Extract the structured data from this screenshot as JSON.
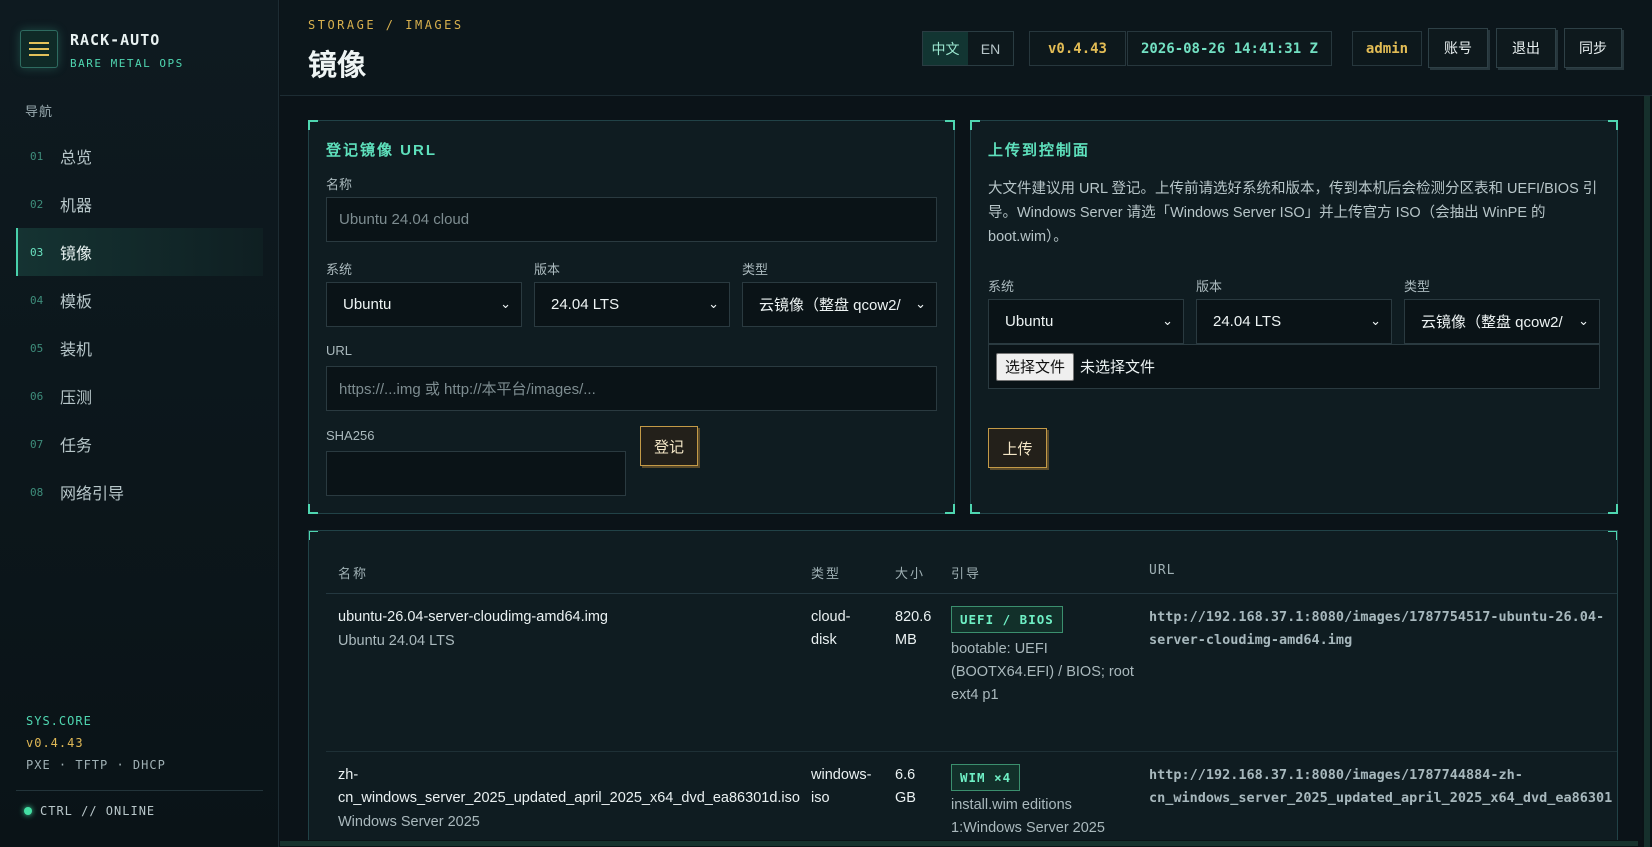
{
  "brand": {
    "title": "RACK-AUTO",
    "subtitle": "BARE METAL OPS"
  },
  "nav": {
    "title": "导航",
    "items": [
      {
        "num": "01",
        "label": "总览"
      },
      {
        "num": "02",
        "label": "机器"
      },
      {
        "num": "03",
        "label": "镜像",
        "active": true
      },
      {
        "num": "04",
        "label": "模板"
      },
      {
        "num": "05",
        "label": "装机"
      },
      {
        "num": "06",
        "label": "压测"
      },
      {
        "num": "07",
        "label": "任务"
      },
      {
        "num": "08",
        "label": "网络引导"
      }
    ]
  },
  "sys": {
    "core": "SYS.CORE",
    "version": "v0.4.43",
    "services": "PXE · TFTP · DHCP",
    "status": "CTRL // ONLINE"
  },
  "header": {
    "breadcrumb": "STORAGE / IMAGES",
    "title": "镜像",
    "lang_zh": "中文",
    "lang_en": "EN",
    "version": "v0.4.43",
    "time": "2026-08-26 14:41:31 Z",
    "user": "admin",
    "account": "账号",
    "logout": "退出",
    "sync": "同步"
  },
  "register": {
    "title": "登记镜像 URL",
    "name_label": "名称",
    "name_placeholder": "Ubuntu 24.04 cloud",
    "os_label": "系统",
    "os_value": "Ubuntu",
    "version_label": "版本",
    "version_value": "24.04 LTS",
    "type_label": "类型",
    "type_value": "云镜像（整盘 qcow2/",
    "url_label": "URL",
    "url_placeholder": "https://...img 或 http://本平台/images/...",
    "sha_label": "SHA256",
    "sha_value": "",
    "submit": "登记"
  },
  "upload": {
    "title": "上传到控制面",
    "description": "大文件建议用 URL 登记。上传前请选好系统和版本，传到本机后会检测分区表和 UEFI/BIOS 引导。Windows Server 请选「Windows Server ISO」并上传官方 ISO（会抽出 WinPE 的 boot.wim）。",
    "os_label": "系统",
    "os_value": "Ubuntu",
    "version_label": "版本",
    "version_value": "24.04 LTS",
    "type_label": "类型",
    "type_value": "云镜像（整盘 qcow2/",
    "file_button": "选择文件",
    "file_status": "未选择文件",
    "submit": "上传"
  },
  "table": {
    "columns": [
      "名称",
      "类型",
      "大小",
      "引导",
      "URL"
    ],
    "rows": [
      {
        "name": "ubuntu-26.04-server-cloudimg-amd64.img",
        "os": "Ubuntu 24.04 LTS",
        "type_lines": [
          "cloud-",
          "disk"
        ],
        "size_lines": [
          "820.6",
          "MB"
        ],
        "badge": "UEFI / BIOS",
        "boot_lines": [
          "bootable: UEFI",
          "(BOOTX64.EFI) / BIOS; root",
          "ext4 p1"
        ],
        "url_lines": [
          "http://192.168.37.1:8080/images/1787754517-ubuntu-26.04-",
          "server-cloudimg-amd64.img"
        ]
      },
      {
        "name_lines": [
          "zh-",
          "cn_windows_server_2025_updated_april_2025_x64_dvd_ea86301d.iso"
        ],
        "os": "Windows Server 2025",
        "type_lines": [
          "windows-",
          "iso"
        ],
        "size_lines": [
          "6.6",
          "GB"
        ],
        "badge": "WIM ×4",
        "boot_lines": [
          "install.wim editions",
          "1:Windows Server 2025"
        ],
        "url_lines": [
          "http://192.168.37.1:8080/images/1787744884-zh-",
          "cn_windows_server_2025_updated_april_2025_x64_dvd_ea86301"
        ]
      }
    ]
  },
  "colors": {
    "accent": "#4fd6b0",
    "gold": "#e2bc55",
    "background": "#0b1318"
  }
}
